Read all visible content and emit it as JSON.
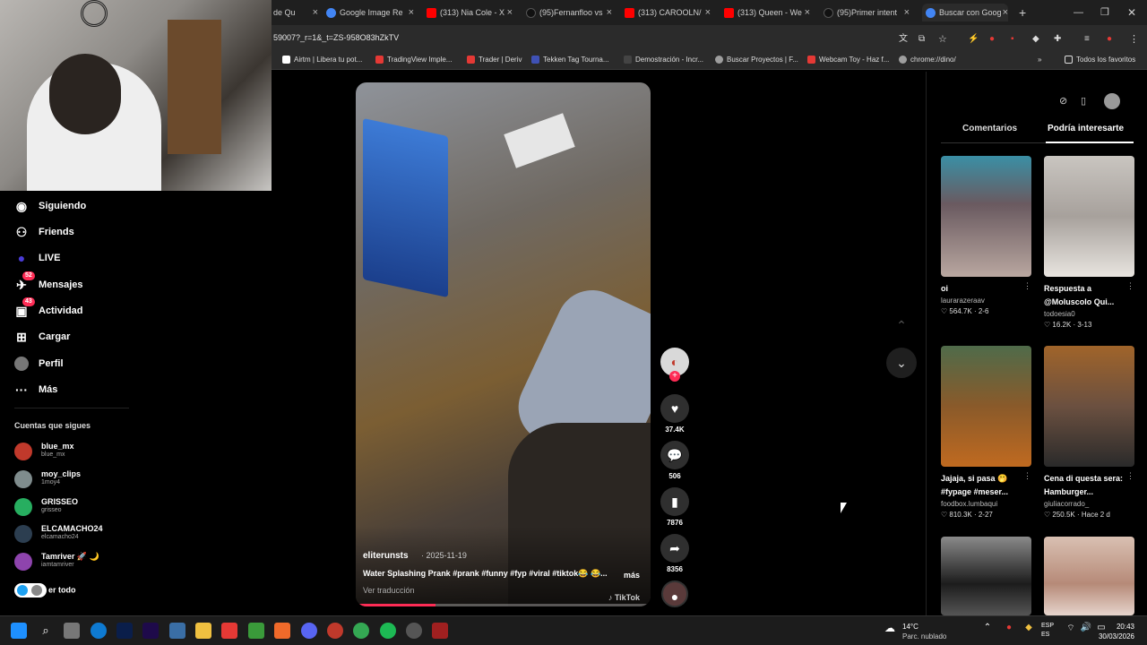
{
  "browser": {
    "tabs": [
      {
        "label": "de Qu",
        "color": "#888888"
      },
      {
        "label": "Google Image Re",
        "color": "#4285f4"
      },
      {
        "label": "(313) Nia Cole - X",
        "color": "#ff0000"
      },
      {
        "label": "(95)Fernanfloo vs",
        "color": "#000000"
      },
      {
        "label": "(313) CAROOLN/",
        "color": "#ff0000"
      },
      {
        "label": "(313) Queen - We",
        "color": "#ff0000"
      },
      {
        "label": "(95)Primer intent",
        "color": "#000000"
      },
      {
        "label": "Buscar con Goog",
        "color": "#4285f4"
      }
    ],
    "url": "59007?_r=1&_t=ZS-958O83hZkTV",
    "bookmarks": [
      {
        "label": "Airtm | Libera tu pot...",
        "color": "#ffffff"
      },
      {
        "label": "TradingView Imple...",
        "color": "#e53935"
      },
      {
        "label": "Trader | Deriv",
        "color": "#e53935"
      },
      {
        "label": "Tekken Tag Tourna...",
        "color": "#3f51b5"
      },
      {
        "label": "Demostración - Incr...",
        "color": "#222222"
      },
      {
        "label": "Buscar Proyectos | F...",
        "color": "#9e9e9e"
      },
      {
        "label": "Webcam Toy - Haz f...",
        "color": "#e53935"
      },
      {
        "label": "chrome://dino/",
        "color": "#9e9e9e"
      }
    ],
    "all_bookmarks": "Todos los favoritos"
  },
  "sidebar": {
    "nav": [
      {
        "label": "Siguiendo",
        "icon": "following-icon",
        "glyph": "◉"
      },
      {
        "label": "Friends",
        "icon": "friends-icon",
        "glyph": "👥"
      },
      {
        "label": "LIVE",
        "icon": "live-icon",
        "glyph": "●"
      },
      {
        "label": "Mensajes",
        "icon": "messages-icon",
        "glyph": "✈",
        "badge": "52"
      },
      {
        "label": "Actividad",
        "icon": "activity-icon",
        "glyph": "▣",
        "badge": "43"
      },
      {
        "label": "Cargar",
        "icon": "upload-icon",
        "glyph": "⊞"
      },
      {
        "label": "Perfil",
        "icon": "profile-icon",
        "glyph": "◉"
      },
      {
        "label": "Más",
        "icon": "more-icon",
        "glyph": "···"
      }
    ],
    "following_title": "Cuentas que sigues",
    "accounts": [
      {
        "name": "blue_mx",
        "handle": "blue_mx",
        "color": "#c0392b"
      },
      {
        "name": "moy_clips",
        "handle": "1moy4",
        "color": "#7f8c8d"
      },
      {
        "name": "GRISSEO",
        "handle": "grisseo",
        "color": "#27ae60"
      },
      {
        "name": "ELCAMACHO24",
        "handle": "elcamacho24",
        "color": "#2c3e50"
      },
      {
        "name": "Tamriver 🚀 🌙",
        "handle": "iamtamriver",
        "color": "#8e44ad"
      }
    ],
    "see_all": "er todo"
  },
  "video": {
    "author": "eliterunsts",
    "date": "· 2025-11-19",
    "caption": "Water Splashing Prank #prank #funny #fyp #viral #tiktok😂 😂...",
    "more": "más",
    "translate": "Ver traducción",
    "watermark": "♪ TikTok",
    "progress": 0.27
  },
  "actions": {
    "likes": "37.4K",
    "comments": "506",
    "saves": "7876",
    "shares": "8356"
  },
  "right_panel": {
    "tabs": [
      "Comentarios",
      "Podría interesarte"
    ],
    "cards": [
      {
        "title": "oi",
        "author": "laurarazeraav",
        "stats": "♡ 564.7K · 2-6",
        "color": "#5a4e52"
      },
      {
        "title": "Respuesta a @Moluscolo Qui...",
        "author": "todoesia0",
        "stats": "♡ 16.2K · 3-13",
        "color": "#b0aba6"
      },
      {
        "title": "Jajaja, si pasa 🤭 #fypage #meser...",
        "author": "foodbox.lumbaqui",
        "stats": "♡ 810.3K · 2-27",
        "color": "#7a4a22"
      },
      {
        "title": "Cena di questa sera: Hamburger...",
        "author": "giuliacorrado_",
        "stats": "♡ 250.5K · Hace 2 d",
        "color": "#8a6a3e"
      },
      {
        "title": "",
        "author": "",
        "stats": "",
        "color": "#2a2a2a"
      },
      {
        "title": "",
        "author": "",
        "stats": "",
        "color": "#c8a898"
      }
    ]
  },
  "taskbar": {
    "weather_temp": "14°C",
    "weather_desc": "Parc. nublado",
    "lang1": "ESP",
    "lang2": "ES",
    "time": "20:43",
    "date": "30/03/2026"
  }
}
